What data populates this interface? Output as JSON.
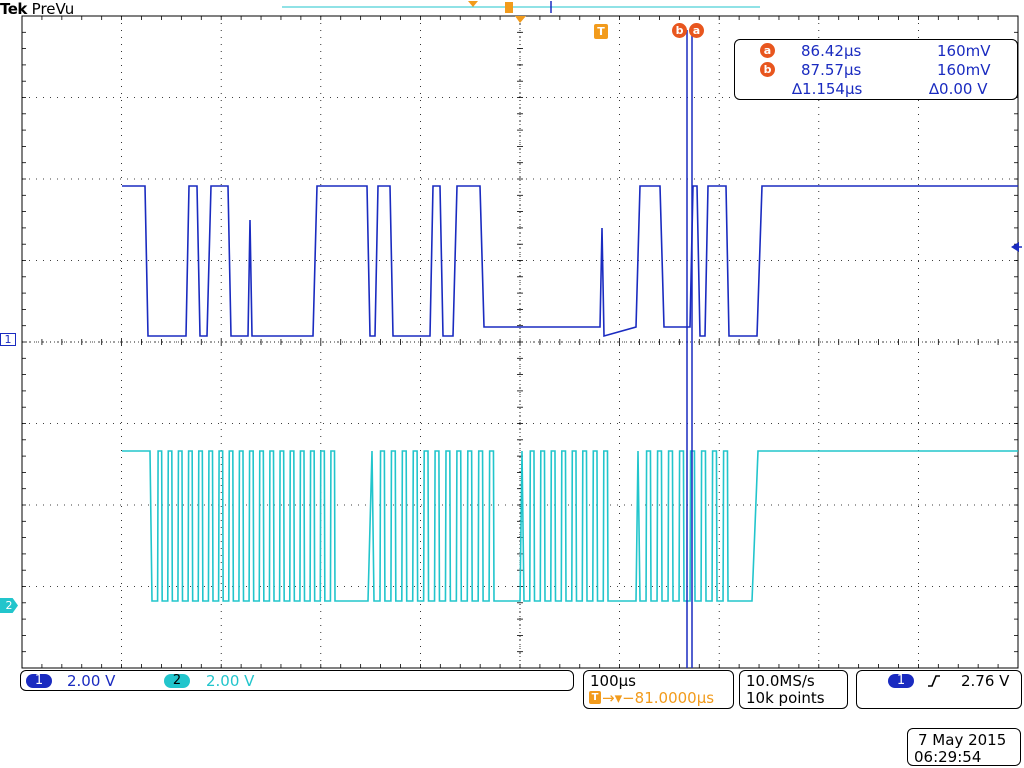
{
  "brand": {
    "logo": "Tek",
    "mode": "PreVu"
  },
  "colors": {
    "ch1": "#1a2bc0",
    "ch2": "#22c5cc",
    "orange": "#f29b1c",
    "cursor_a": "#e8561e",
    "grid": "#000000"
  },
  "markers": {
    "trigger_label": "T",
    "cursor_b_label": "b",
    "cursor_a_label": "a",
    "ch1_label": "1",
    "ch2_label": "2"
  },
  "readout": {
    "a": {
      "label": "a",
      "time": "86.42µs",
      "volt": "160mV"
    },
    "b": {
      "label": "b",
      "time": "87.57µs",
      "volt": "160mV"
    },
    "delta": {
      "time": "∆1.154µs",
      "volt": "∆0.00 V"
    }
  },
  "channels": {
    "ch1": {
      "num": "1",
      "scale": "2.00 V"
    },
    "ch2": {
      "num": "2",
      "scale": "2.00 V"
    }
  },
  "timebase": {
    "scale": "100µs",
    "trig_icon": "T",
    "offset": "→▾−81.0000µs"
  },
  "acq": {
    "rate": "10.0MS/s",
    "points": "10k points"
  },
  "trigger": {
    "src": "1",
    "slope_icon": "rising-edge-icon",
    "level": "2.76 V"
  },
  "date": {
    "date": "7 May 2015",
    "time": "06:29:54"
  }
}
